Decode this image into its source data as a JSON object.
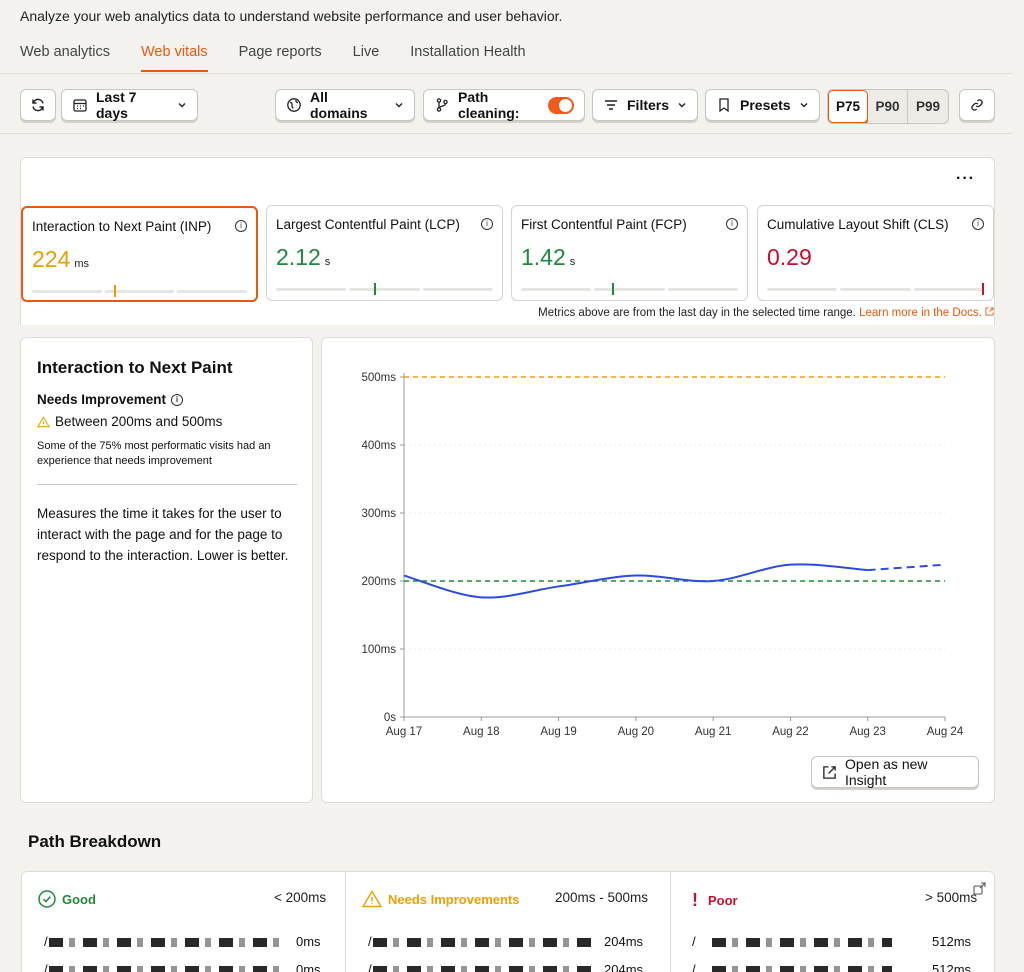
{
  "page": {
    "subtitle": "Analyze your web analytics data to understand website performance and user behavior."
  },
  "tabs": [
    {
      "label": "Web analytics",
      "active": false
    },
    {
      "label": "Web vitals",
      "active": true
    },
    {
      "label": "Page reports",
      "active": false
    },
    {
      "label": "Live",
      "active": false
    },
    {
      "label": "Installation Health",
      "active": false
    }
  ],
  "toolbar": {
    "date_range": "Last 7 days",
    "domains": "All domains",
    "path_cleaning": "Path cleaning:",
    "path_cleaning_on": true,
    "filters": "Filters",
    "presets": "Presets",
    "percentiles": [
      "P75",
      "P90",
      "P99"
    ],
    "active_percentile": "P75"
  },
  "menu_dots": "···",
  "metrics": [
    {
      "title": "Interaction to Next Paint (INP)",
      "value": "224",
      "unit": "ms",
      "color": "#e8a000",
      "tick_color": "#e8a000",
      "level": 0.38
    },
    {
      "title": "Largest Contentful Paint (LCP)",
      "value": "2.12",
      "unit": "s",
      "color": "#1e8a3c",
      "tick_color": "#1e8a3c",
      "level": 0.45
    },
    {
      "title": "First Contentful Paint (FCP)",
      "value": "1.42",
      "unit": "s",
      "color": "#1e8a3c",
      "tick_color": "#1e8a3c",
      "level": 0.42
    },
    {
      "title": "Cumulative Layout Shift (CLS)",
      "value": "0.29",
      "unit": "",
      "color": "#c8102e",
      "tick_color": "#c8102e",
      "level": 0.99
    }
  ],
  "metrics_note": "Metrics above are from the last day in the selected time range.",
  "metrics_note_link": "Learn more in the Docs.",
  "detail": {
    "title": "Interaction to Next Paint",
    "status": "Needs Improvement",
    "range": "Between 200ms and 500ms",
    "explain": "Some of the 75% most performatic visits had an experience that needs improvement",
    "description": "Measures the time it takes for the user to interact with the page and for the page to respond to the interaction. Lower is better."
  },
  "chart_data": {
    "type": "line",
    "x": [
      "Aug 17",
      "Aug 18",
      "Aug 19",
      "Aug 20",
      "Aug 21",
      "Aug 22",
      "Aug 23",
      "Aug 24"
    ],
    "series": [
      {
        "values": [
          208,
          176,
          192,
          208,
          200,
          224,
          216,
          224
        ],
        "color": "#2c4be0",
        "dashed_from_index": 6
      }
    ],
    "thresholds": [
      {
        "value": 500,
        "color": "#f0a000"
      },
      {
        "value": 200,
        "color": "#1e8a3c"
      }
    ],
    "yticks": [
      "0s",
      "100ms",
      "200ms",
      "300ms",
      "400ms",
      "500ms"
    ],
    "ylim": [
      0,
      500
    ],
    "grid": true
  },
  "open_insight": "Open as new Insight",
  "path_breakdown": {
    "title": "Path Breakdown",
    "columns": [
      {
        "label": "Good",
        "range": "< 200ms",
        "color": "#1e8a3c",
        "values": [
          "0ms",
          "0ms"
        ]
      },
      {
        "label": "Needs Improvements",
        "range": "200ms - 500ms",
        "color": "#f0a000",
        "values": [
          "204ms",
          "204ms"
        ]
      },
      {
        "label": "Poor",
        "range": "> 500ms",
        "color": "#c8102e",
        "values": [
          "512ms",
          "512ms"
        ]
      }
    ],
    "path_prefix": "/"
  }
}
